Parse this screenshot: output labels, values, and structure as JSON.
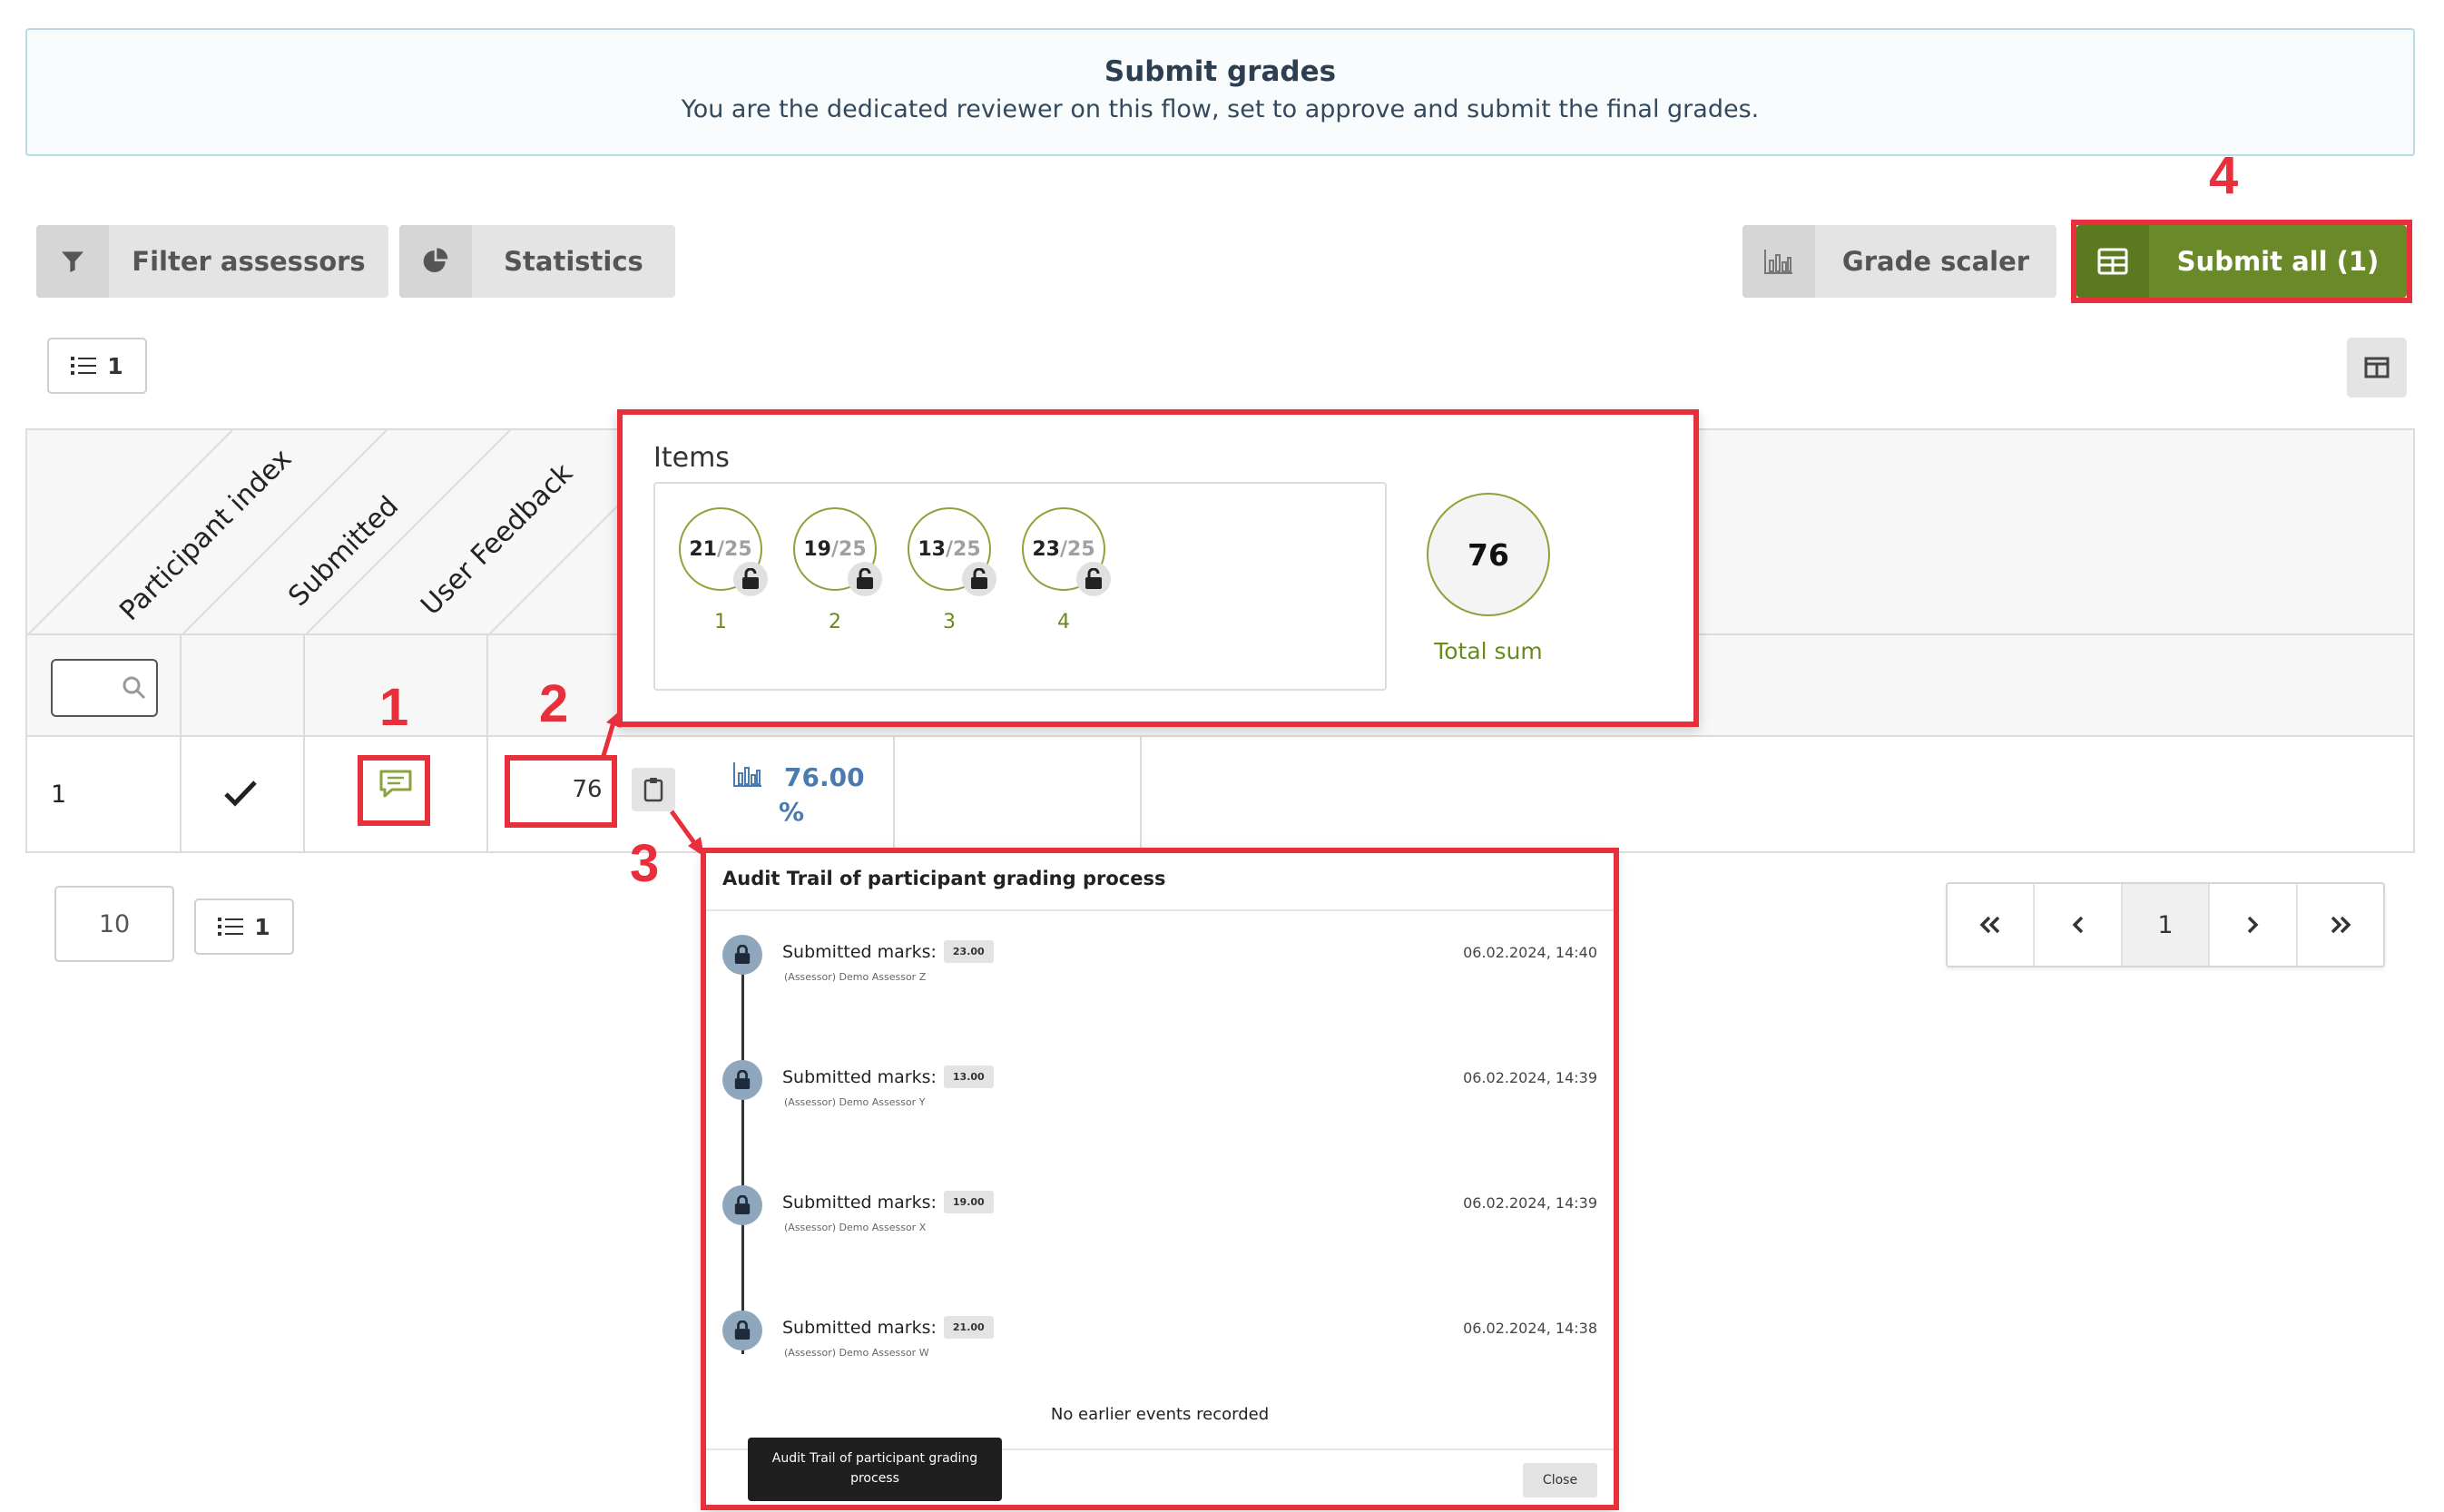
{
  "banner": {
    "title": "Submit grades",
    "subtitle": "You are the dedicated reviewer on this flow, set to approve and submit the final grades."
  },
  "toolbar": {
    "filter_label": "Filter assessors",
    "statistics_label": "Statistics",
    "grade_scaler_label": "Grade scaler",
    "submit_all_label": "Submit all (1)",
    "rows_count": "1"
  },
  "annotations": [
    "1",
    "2",
    "3",
    "4"
  ],
  "table": {
    "headers": [
      "Participant index",
      "Submitted",
      "User Feedback"
    ],
    "row": {
      "index": "1",
      "grade": "76",
      "percent": "76.00",
      "percent_sign": "%"
    }
  },
  "items_popover": {
    "title": "Items",
    "items": [
      {
        "score": "21",
        "max": "/25",
        "label": "1"
      },
      {
        "score": "19",
        "max": "/25",
        "label": "2"
      },
      {
        "score": "13",
        "max": "/25",
        "label": "3"
      },
      {
        "score": "23",
        "max": "/25",
        "label": "4"
      }
    ],
    "total": "76",
    "total_label": "Total sum"
  },
  "audit": {
    "title": "Audit Trail of participant grading process",
    "events": [
      {
        "title": "Submitted marks:",
        "badge": "23.00",
        "assessor": "(Assessor) Demo Assessor Z",
        "time": "06.02.2024, 14:40"
      },
      {
        "title": "Submitted marks:",
        "badge": "13.00",
        "assessor": "(Assessor) Demo Assessor Y",
        "time": "06.02.2024, 14:39"
      },
      {
        "title": "Submitted marks:",
        "badge": "19.00",
        "assessor": "(Assessor) Demo Assessor X",
        "time": "06.02.2024, 14:39"
      },
      {
        "title": "Submitted marks:",
        "badge": "21.00",
        "assessor": "(Assessor) Demo Assessor W",
        "time": "06.02.2024, 14:38"
      }
    ],
    "no_events": "No earlier events recorded",
    "close_label": "Close",
    "tooltip": "Audit Trail of participant grading process"
  },
  "pagination": {
    "page_size": "10",
    "rows_count": "1",
    "current_page": "1"
  },
  "colors": {
    "accent_green": "#6a8a2a",
    "annotation_red": "#e8303d",
    "percent_blue": "#4a7ab0"
  }
}
